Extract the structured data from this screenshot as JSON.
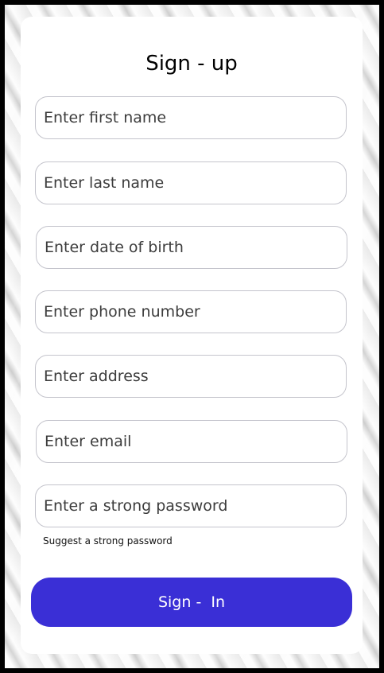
{
  "form": {
    "title": "Sign - up",
    "fields": [
      {
        "placeholder": "Enter first name",
        "value": ""
      },
      {
        "placeholder": "Enter last name",
        "value": ""
      },
      {
        "placeholder": "Enter date of birth",
        "value": ""
      },
      {
        "placeholder": "Enter phone number",
        "value": ""
      },
      {
        "placeholder": "Enter address",
        "value": ""
      },
      {
        "placeholder": "Enter email",
        "value": ""
      },
      {
        "placeholder": "Enter a strong password",
        "value": ""
      }
    ],
    "password_hint": "Suggest a strong password",
    "submit_label": "Sign -  In"
  },
  "colors": {
    "button": "#3a2fd6",
    "card": "#ffffff",
    "frame": "#000000"
  }
}
